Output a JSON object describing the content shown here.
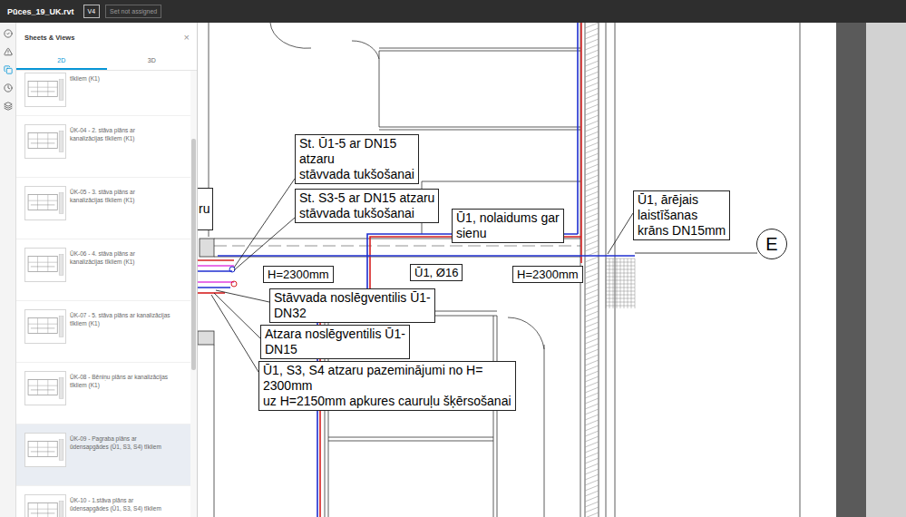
{
  "app_bar": {
    "title": "Pūces_19_UK.rvt",
    "version": "V4",
    "set_button": "Set not assigned"
  },
  "rail": [
    {
      "selected": false
    },
    {
      "selected": false
    },
    {
      "selected": true
    },
    {
      "selected": false
    },
    {
      "selected": false
    }
  ],
  "panel": {
    "title": "Sheets & Views",
    "close": "×",
    "tabs": [
      {
        "label": "2D",
        "selected": true
      },
      {
        "label": "3D",
        "selected": false
      }
    ],
    "items": [
      {
        "lines": [
          "tīkliem (K1)"
        ],
        "selected": false,
        "partial": true
      },
      {
        "lines": [
          "ŪK-04 - 2. stāva plāns ar",
          "kanalizācijas tīkliem (K1)"
        ],
        "selected": false,
        "partial": false
      },
      {
        "lines": [
          "ŪK-05 - 3. stāva plāns ar",
          "kanalizācijas tīkliem (K1)"
        ],
        "selected": false,
        "partial": false
      },
      {
        "lines": [
          "ŪK-06 - 4. stāva plāns ar",
          "kanalizācijas tīkliem (K1)"
        ],
        "selected": false,
        "partial": false
      },
      {
        "lines": [
          "ŪK-07 - 5. stāva plāns ar kanalizācijas",
          "tīkliem (K1)"
        ],
        "selected": false,
        "partial": false
      },
      {
        "lines": [
          "ŪK-08 - Bēniņu plāns ar kanalizācijas",
          "tīkliem (K1)"
        ],
        "selected": false,
        "partial": false
      },
      {
        "lines": [
          "ŪK-09 - Pagraba plāns ar",
          "ūdensapgādes (Ū1, S3, S4) tīkliem"
        ],
        "selected": true,
        "partial": false
      },
      {
        "lines": [
          "ŪK-10 - 1.stāva plāns ar",
          "ūdensapgādes (Ū1, S3, S4) tīkliem"
        ],
        "selected": false,
        "partial": false
      }
    ]
  },
  "drawing": {
    "edge_label": "ru",
    "callouts": [
      {
        "lines": [
          "St. Ū1-5 ar DN15",
          "atzaru",
          "stāvvada tukšošanai"
        ]
      },
      {
        "lines": [
          "St. S3-5 ar DN15 atzaru",
          "stāvvada tukšošanai"
        ]
      },
      {
        "lines": [
          "Ū1, nolaidums gar",
          "sienu"
        ]
      },
      {
        "lines": [
          "Ū1, ārējais",
          "laistīšanas",
          "krāns DN15mm"
        ]
      },
      {
        "lines": [
          "Stāvvada noslēgventilis Ū1-",
          "DN32"
        ]
      },
      {
        "lines": [
          "Atzara noslēgventilis Ū1-",
          "DN15"
        ]
      },
      {
        "lines": [
          "Ū1, S3, S4 atzaru pazeminājumi no H=",
          "2300mm",
          "uz H=2150mm apkures cauruļu šķērsošanai"
        ]
      }
    ],
    "tags": [
      "H=2300mm",
      "Ū1, Ø16",
      "H=2300mm"
    ],
    "grid_bubble": "E"
  }
}
